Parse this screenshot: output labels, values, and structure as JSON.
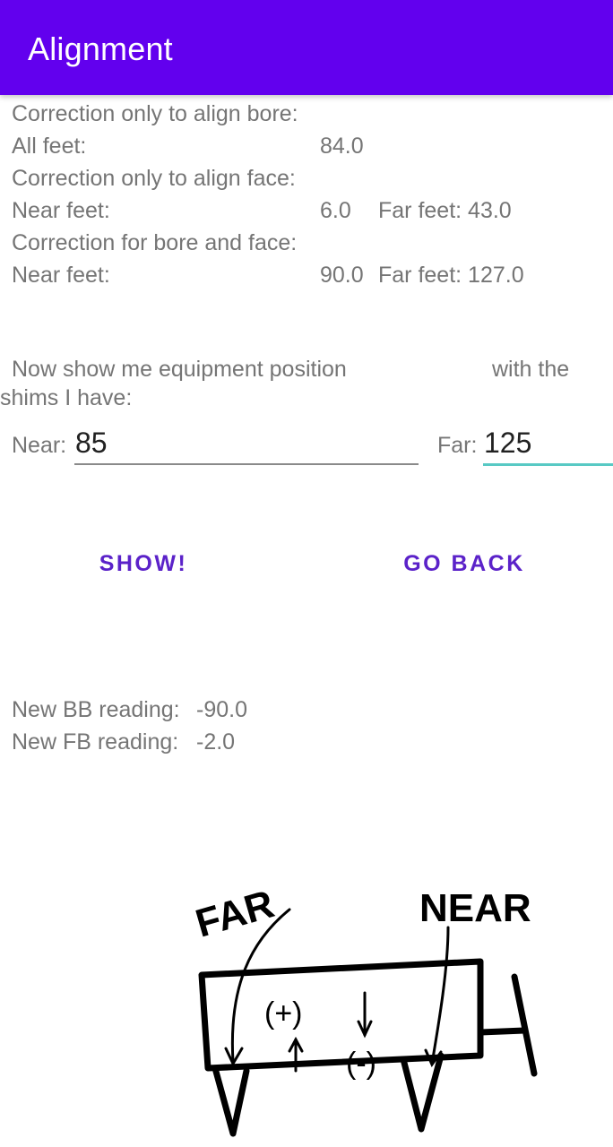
{
  "app": {
    "title": "Alignment"
  },
  "bore": {
    "heading": "Correction only to align bore:",
    "all_feet_label": "All feet:",
    "all_feet_value": "84.0"
  },
  "face": {
    "heading": "Correction only to align face:",
    "near_label": "Near feet:",
    "near_value": "6.0",
    "far_text": "Far feet: 43.0"
  },
  "combined": {
    "heading": "Correction for bore and face:",
    "near_label": "Near feet:",
    "near_value": "90.0",
    "far_text": "Far feet: 127.0"
  },
  "prompt": {
    "line1_left": "Now show me equipment position",
    "line1_right": "with the",
    "line2": "shims I have:"
  },
  "inputs": {
    "near_label": "Near:",
    "near_value": "85",
    "far_label": "Far:",
    "far_value": "125"
  },
  "buttons": {
    "show": "SHOW!",
    "back": "GO BACK"
  },
  "results": {
    "bb_label": "New BB reading:",
    "bb_value": "-90.0",
    "fb_label": "New FB reading:",
    "fb_value": "-2.0"
  },
  "diagram": {
    "far_label": "FAR",
    "near_label": "NEAR",
    "plus_label": "(+)",
    "minus_label": "(-)"
  },
  "colors": {
    "appbar": "#6200EE",
    "button_text": "#5B22C9",
    "focus_underline": "#58C9C4"
  }
}
